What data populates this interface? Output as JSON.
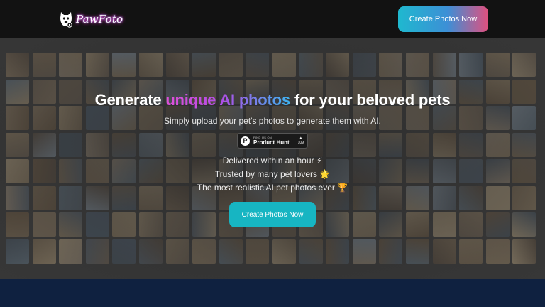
{
  "header": {
    "logo_text": "PawFoto",
    "logo_icon": "dog-head-icon",
    "cta_label": "Create Photos Now"
  },
  "hero": {
    "headline_pre": "Generate ",
    "headline_highlight": "unique AI photos",
    "headline_post": " for your beloved pets",
    "subheadline": "Simply upload your pet's photos to generate them with AI.",
    "product_hunt": {
      "small": "FIND US ON",
      "name": "Product Hunt",
      "letter": "P",
      "arrow": "▲",
      "votes": "109"
    },
    "features": [
      "Delivered within an hour ⚡",
      "Trusted by many pet lovers 🌟",
      "The most realistic AI pet photos ever 🏆"
    ],
    "cta_label": "Create Photos Now",
    "mosaic_icon": "pet-photo-grid"
  },
  "colors": {
    "header_bg": "#121212",
    "hero_bg": "#3f3f3f",
    "accent_cyan": "#17b5c2",
    "accent_pink": "#e04fd8",
    "footer_bg": "#0f2140"
  }
}
